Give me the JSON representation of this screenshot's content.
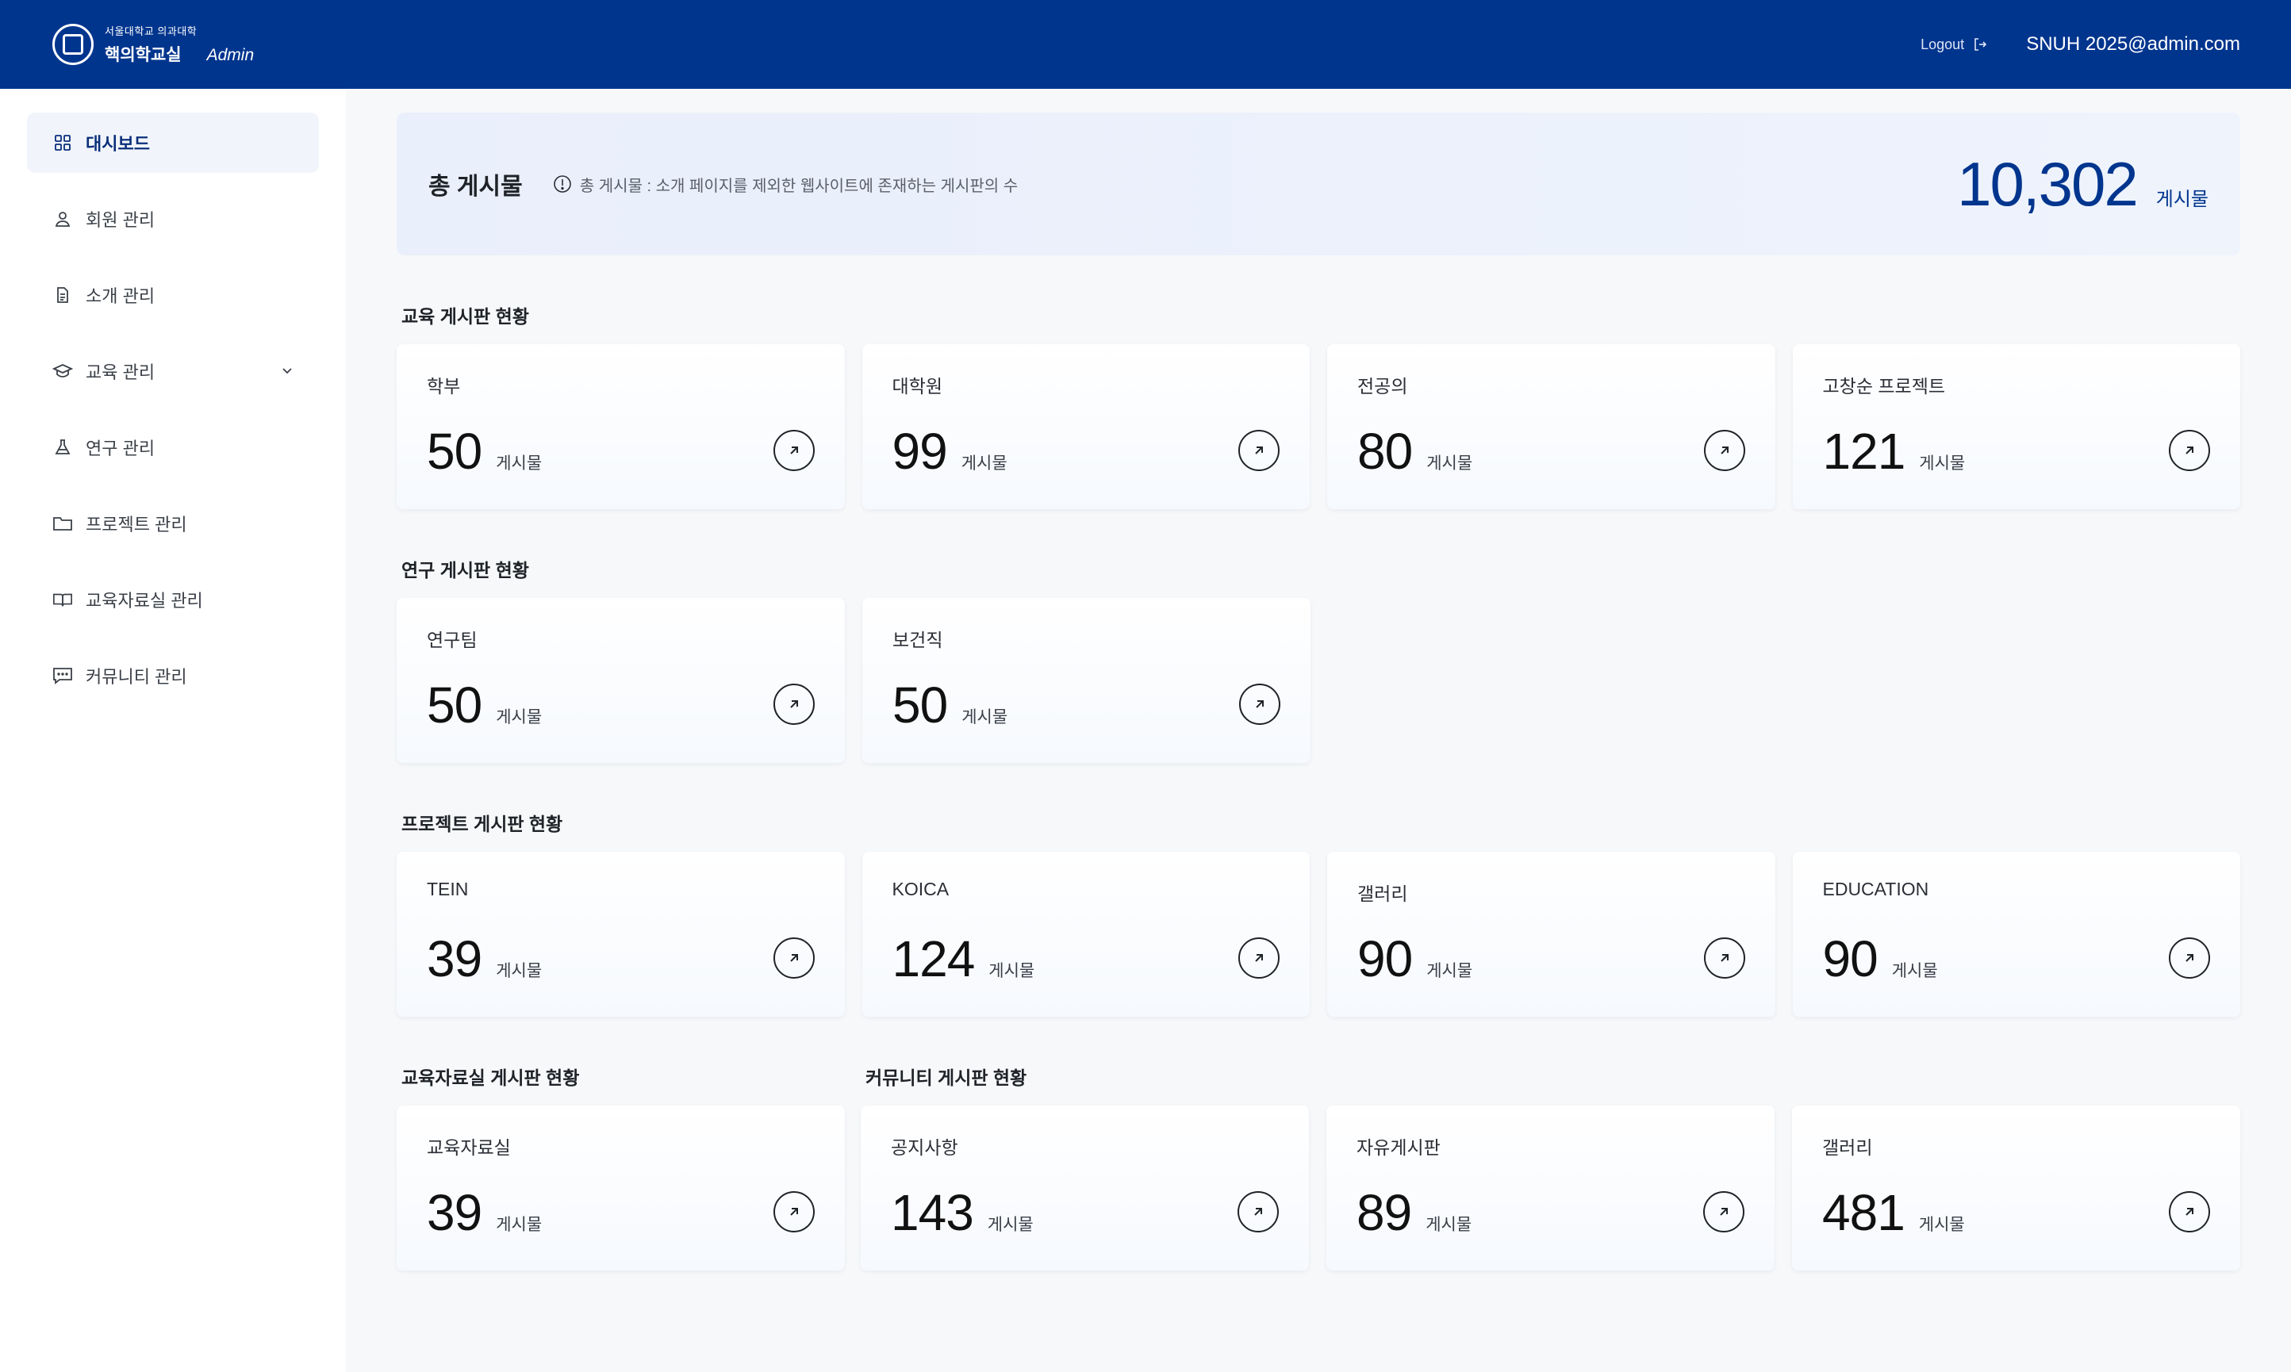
{
  "header": {
    "brand_sub": "서울대학교 의과대학",
    "brand_main": "핵의학교실",
    "brand_admin": "Admin",
    "logout": "Logout",
    "user_email": "SNUH 2025@admin.com"
  },
  "sidebar": {
    "items": [
      {
        "label": "대시보드",
        "icon": "grid-icon"
      },
      {
        "label": "회원 관리",
        "icon": "user-icon"
      },
      {
        "label": "소개 관리",
        "icon": "document-icon"
      },
      {
        "label": "교육 관리",
        "icon": "graduation-cap-icon"
      },
      {
        "label": "연구 관리",
        "icon": "flask-icon"
      },
      {
        "label": "프로젝트 관리",
        "icon": "folder-icon"
      },
      {
        "label": "교육자료실 관리",
        "icon": "book-icon"
      },
      {
        "label": "커뮤니티 관리",
        "icon": "chat-icon"
      }
    ]
  },
  "total": {
    "title": "총 게시물",
    "note": "총 게시물 : 소개 페이지를 제외한 웹사이트에 존재하는 게시판의 수",
    "value": "10,302",
    "unit": "게시물"
  },
  "unit": "게시물",
  "sections": {
    "education": {
      "title": "교육 게시판 현황",
      "cards": [
        {
          "label": "학부",
          "value": "50"
        },
        {
          "label": "대학원",
          "value": "99"
        },
        {
          "label": "전공의",
          "value": "80"
        },
        {
          "label": "고창순 프로젝트",
          "value": "121"
        }
      ]
    },
    "research": {
      "title": "연구 게시판 현황",
      "cards": [
        {
          "label": "연구팀",
          "value": "50"
        },
        {
          "label": "보건직",
          "value": "50"
        }
      ]
    },
    "project": {
      "title": "프로젝트 게시판 현황",
      "cards": [
        {
          "label": "TEIN",
          "value": "39"
        },
        {
          "label": "KOICA",
          "value": "124"
        },
        {
          "label": "갤러리",
          "value": "90"
        },
        {
          "label": "EDUCATION",
          "value": "90"
        }
      ]
    },
    "resources": {
      "title": "교육자료실 게시판 현황",
      "cards": [
        {
          "label": "교육자료실",
          "value": "39"
        }
      ]
    },
    "community": {
      "title": "커뮤니티 게시판 현황",
      "cards": [
        {
          "label": "공지사항",
          "value": "143"
        },
        {
          "label": "자유게시판",
          "value": "89"
        },
        {
          "label": "갤러리",
          "value": "481"
        }
      ]
    }
  },
  "colors": {
    "header_bg": "#00358e",
    "accent": "#00358e",
    "active_nav_bg": "#f1f5fb"
  }
}
